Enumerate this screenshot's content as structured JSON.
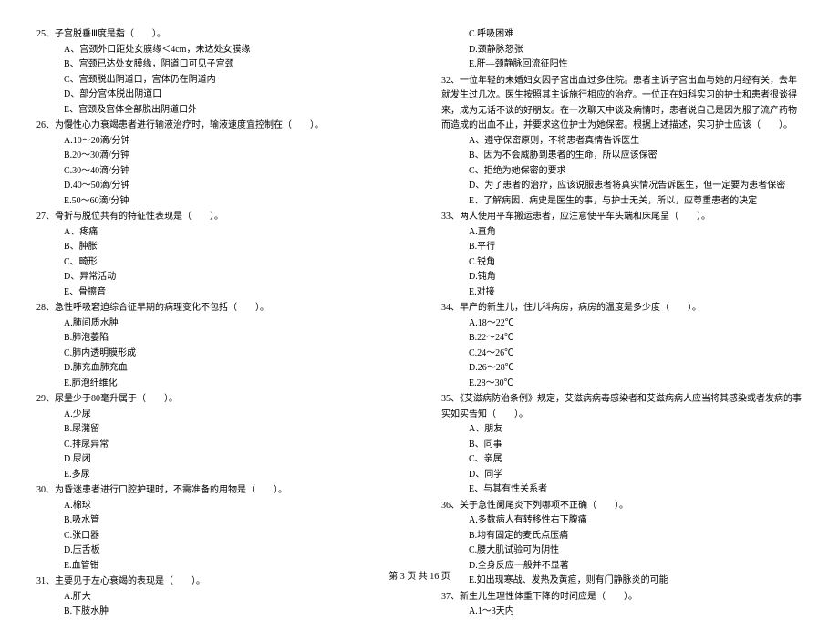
{
  "left": {
    "q25": {
      "stem": "25、子宫脱垂Ⅲ度是指（　　）。",
      "a": "A、宫颈外口距处女膜缘＜4cm，未达处女膜缘",
      "b": "B、宫颈已达处女膜缘，阴道口可见子宫颈",
      "c": "C、宫颈脱出阴道口，宫体仍在阴道内",
      "d": "D、部分宫体脱出阴道口",
      "e": "E、宫颈及宫体全部脱出阴道口外"
    },
    "q26": {
      "stem": "26、为慢性心力衰竭患者进行输液治疗时，输液速度宜控制在（　　）。",
      "a": "A.10～20滴/分钟",
      "b": "B.20～30滴/分钟",
      "c": "C.30～40滴/分钟",
      "d": "D.40～50滴/分钟",
      "e": "E.50～60滴/分钟"
    },
    "q27": {
      "stem": "27、骨折与脱位共有的特征性表现是（　　）。",
      "a": "A、疼痛",
      "b": "B、肿胀",
      "c": "C、畸形",
      "d": "D、异常活动",
      "e": "E、骨擦音"
    },
    "q28": {
      "stem": "28、急性呼吸窘迫综合征早期的病理变化不包括（　　）。",
      "a": "A.肺间质水肿",
      "b": "B.肺泡萎陷",
      "c": "C.肺内透明膜形成",
      "d": "D.肺充血肺充血",
      "e": "E.肺泡纤维化"
    },
    "q29": {
      "stem": "29、尿量少于80毫升属于（　　）。",
      "a": "A.少尿",
      "b": "B.尿潴留",
      "c": "C.排尿异常",
      "d": "D.尿闭",
      "e": "E.多尿"
    },
    "q30": {
      "stem": "30、为昏迷患者进行口腔护理时，不需准备的用物是（　　）。",
      "a": "A.棉球",
      "b": "B.吸水管",
      "c": "C.张口器",
      "d": "D.压舌板",
      "e": "E.血管钳"
    },
    "q31": {
      "stem": "31、主要见于左心衰竭的表现是（　　）。",
      "a": "A.肝大",
      "b": "B.下肢水肿"
    }
  },
  "right": {
    "q31cont": {
      "c": "C.呼吸困难",
      "d": "D.颈静脉怒张",
      "e": "E.肝—颈静脉回流征阳性"
    },
    "q32": {
      "stem": "32、一位年轻的未婚妇女因子宫出血过多住院。患者主诉子宫出血与她的月经有关，去年就发生过几次。医生按照其主诉施行相应的治疗。一位正在妇科实习的护士和患者很谈得来，成为无话不谈的好朋友。在一次聊天中谈及病情时，患者说自己是因为服了流产药物而造成的出血不止，并要求这位护士为她保密。根据上述描述，实习护士应该（　　）。",
      "a": "A、遵守保密原则，不将患者真情告诉医生",
      "b": "B、因为不会威胁到患者的生命，所以应该保密",
      "c": "C、拒绝为她保密的要求",
      "d": "D、为了患者的治疗，应该说服患者将真实情况告诉医生，但一定要为患者保密",
      "e": "E、了解病因、病史是医生的事，与护士无关，所以，应尊重患者的决定"
    },
    "q33": {
      "stem": "33、两人使用平车搬运患者，应注意使平车头端和床尾呈（　　）。",
      "a": "A.直角",
      "b": "B.平行",
      "c": "C.锐角",
      "d": "D.钝角",
      "e": "E.对接"
    },
    "q34": {
      "stem": "34、早产的新生儿，住儿科病房，病房的温度是多少度（　　）。",
      "a": "A.18～22℃",
      "b": "B.22～24℃",
      "c": "C.24～26℃",
      "d": "D.26～28℃",
      "e": "E.28～30℃"
    },
    "q35": {
      "stem": "35、《艾滋病防治条例》规定，艾滋病病毒感染者和艾滋病病人应当将其感染或者发病的事实如实告知（　　）。",
      "a": "A、朋友",
      "b": "B、同事",
      "c": "C、亲属",
      "d": "D、同学",
      "e": "E、与其有性关系者"
    },
    "q36": {
      "stem": "36、关于急性阑尾炎下列哪项不正确（　　）。",
      "a": "A.多数病人有转移性右下腹痛",
      "b": "B.均有固定的麦氏点压痛",
      "c": "C.腰大肌试验可为阴性",
      "d": "D.全身反应一般并不显著",
      "e": "E.如出现寒战、发热及黄疸，则有门静脉炎的可能"
    },
    "q37": {
      "stem": "37、新生儿生理性体重下降的时间应是（　　）。",
      "a": "A.1～3天内"
    }
  },
  "footer": "第 3 页 共 16 页"
}
